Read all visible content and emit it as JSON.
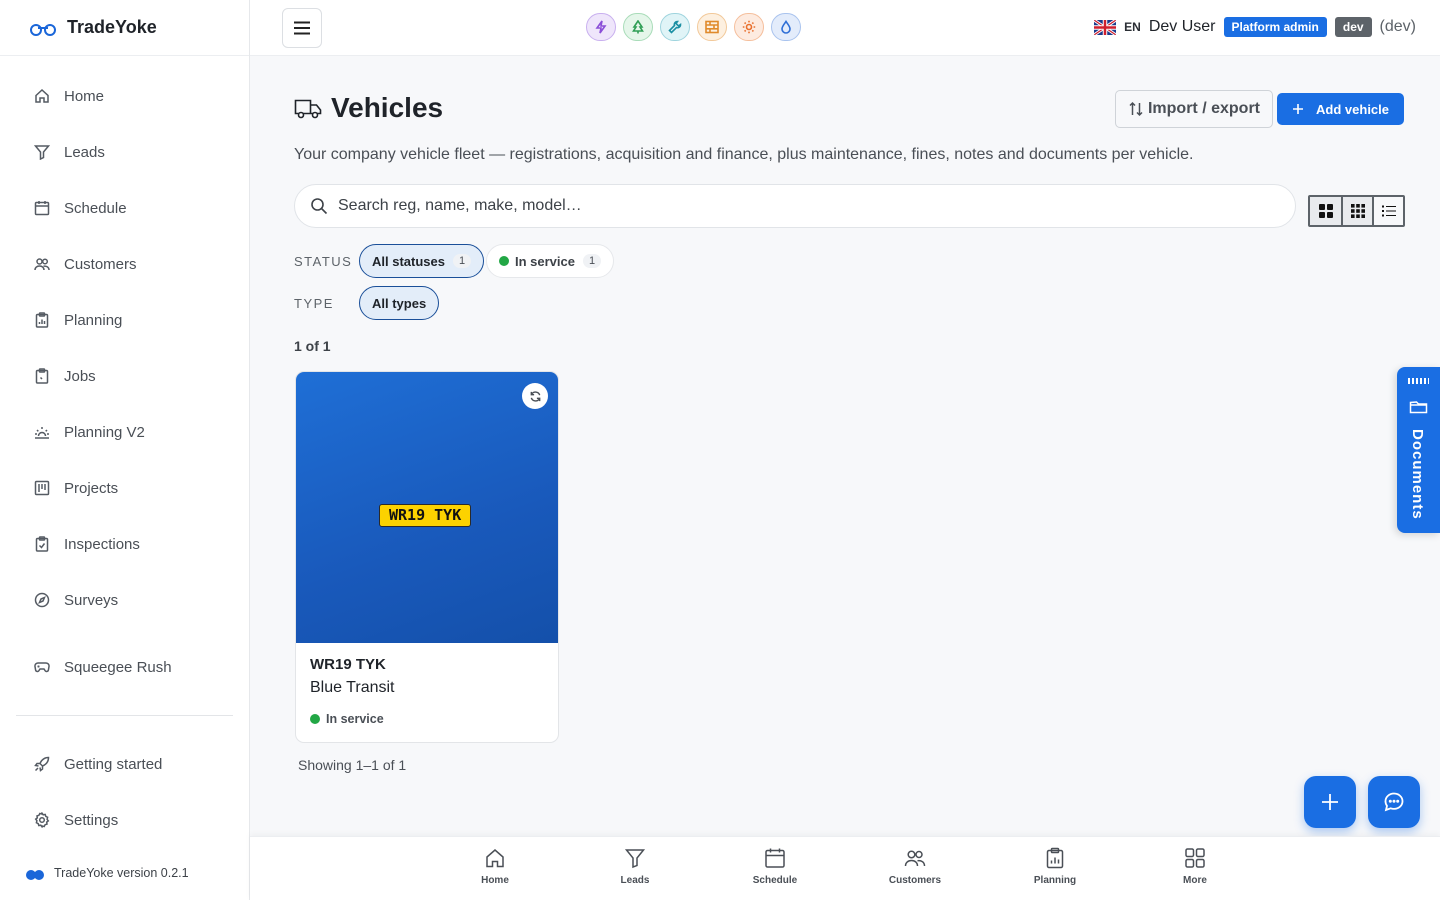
{
  "app": {
    "name": "TradeYoke",
    "version_text": "TradeYoke version 0.2.1"
  },
  "sidebar": {
    "items": [
      {
        "label": "Home",
        "icon": "home-icon"
      },
      {
        "label": "Leads",
        "icon": "funnel-icon"
      },
      {
        "label": "Schedule",
        "icon": "calendar-icon"
      },
      {
        "label": "Customers",
        "icon": "users-icon"
      },
      {
        "label": "Planning",
        "icon": "clipboard-chart-icon"
      },
      {
        "label": "Jobs",
        "icon": "clipboard-icon"
      },
      {
        "label": "Planning V2",
        "icon": "sunrise-icon"
      },
      {
        "label": "Projects",
        "icon": "kanban-icon"
      },
      {
        "label": "Inspections",
        "icon": "clipboard-check-icon"
      },
      {
        "label": "Surveys",
        "icon": "compass-icon"
      },
      {
        "label": "Squeegee Rush",
        "icon": "gamepad-icon"
      }
    ],
    "bottom_items": [
      {
        "label": "Getting started",
        "icon": "rocket-icon"
      },
      {
        "label": "Settings",
        "icon": "gear-icon"
      }
    ]
  },
  "topbar": {
    "trade_icons": [
      {
        "name": "lightning-icon",
        "color": "#8b4fd8",
        "bg": "#efe6fb"
      },
      {
        "name": "tree-icon",
        "color": "#2f9e55",
        "bg": "#e5f6ea"
      },
      {
        "name": "wrench-icon",
        "color": "#1b8fa3",
        "bg": "#e0f4f7"
      },
      {
        "name": "brick-icon",
        "color": "#e08a2b",
        "bg": "#fdf0e0"
      },
      {
        "name": "sun-icon",
        "color": "#e8702e",
        "bg": "#fdebe0"
      },
      {
        "name": "drop-icon",
        "color": "#2f6fd6",
        "bg": "#e3ecfb"
      }
    ],
    "language": "EN",
    "user_name": "Dev User",
    "role_badge": "Platform admin",
    "env_badge": "dev",
    "env_label": "(dev)"
  },
  "page": {
    "title": "Vehicles",
    "subtitle": "Your company vehicle fleet — registrations, acquisition and finance, plus maintenance, fines, notes and documents per vehicle.",
    "import_label": "Import / export",
    "add_label": "Add vehicle",
    "search_placeholder": "Search reg, name, make, model…"
  },
  "filters": {
    "status_label": "STATUS",
    "type_label": "TYPE",
    "status_chips": [
      {
        "label": "All statuses",
        "count": "1"
      },
      {
        "label": "In service",
        "count": "1"
      }
    ],
    "type_chips": [
      {
        "label": "All types"
      }
    ]
  },
  "results": {
    "count_text": "1 of 1",
    "showing_text": "Showing 1–1 of 1"
  },
  "vehicles": [
    {
      "plate": "WR19 TYK",
      "reg": "WR19 TYK",
      "name": "Blue Transit",
      "status": "In service",
      "status_color": "#22a745"
    }
  ],
  "documents_tab": {
    "label": "Documents"
  },
  "bottom_nav": [
    {
      "label": "Home",
      "icon": "home-icon"
    },
    {
      "label": "Leads",
      "icon": "funnel-icon"
    },
    {
      "label": "Schedule",
      "icon": "calendar-icon"
    },
    {
      "label": "Customers",
      "icon": "users-icon"
    },
    {
      "label": "Planning",
      "icon": "clipboard-chart-icon"
    },
    {
      "label": "More",
      "icon": "grid-icon"
    }
  ],
  "colors": {
    "accent": "#1a6ee3",
    "success": "#22a745",
    "plate": "#fcd200"
  }
}
